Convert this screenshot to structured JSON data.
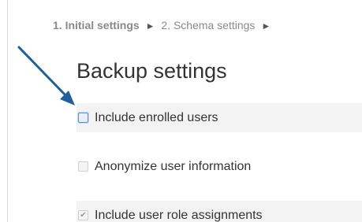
{
  "breadcrumb": {
    "step1": "1. Initial settings",
    "separator": "►",
    "step2": "2. Schema settings",
    "trailing_separator": "►"
  },
  "page_title": "Backup settings",
  "settings": [
    {
      "label": "Include enrolled users",
      "checked": false,
      "enabled": true
    },
    {
      "label": "Anonymize user information",
      "checked": false,
      "enabled": false
    },
    {
      "label": "Include user role assignments",
      "checked": true,
      "enabled": false
    }
  ],
  "annotation": {
    "icon": "arrow-pointer-icon",
    "color": "#1f5f9e"
  }
}
